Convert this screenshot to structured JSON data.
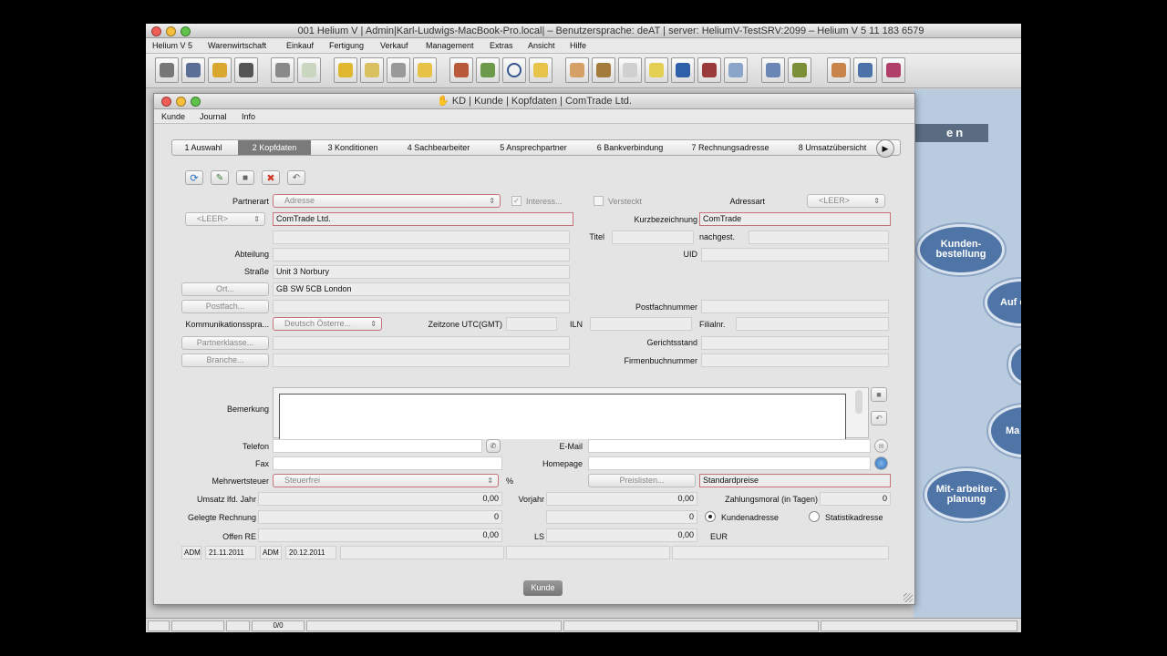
{
  "app": {
    "title": "001 Helium V | Admin|Karl-Ludwigs-MacBook-Pro.local| – Benutzersprache: deAT | server: HeliumV-TestSRV:2099 – Helium V 5 11 183 6579",
    "menu": [
      "Helium V 5",
      "Warenwirtschaft",
      "Einkauf",
      "Fertigung",
      "Verkauf",
      "Management",
      "Extras",
      "Ansicht",
      "Hilfe"
    ]
  },
  "background_panel": {
    "banner": "en",
    "bubbles": [
      "Kunden- bestellung",
      "Auf ert",
      "Ma be f",
      "Mit- arbeiter- planung"
    ]
  },
  "frame": {
    "title": "KD | Kunde | Kopfdaten | ComTrade Ltd.",
    "menu": [
      "Kunde",
      "Journal",
      "Info"
    ],
    "tabs": [
      "1 Auswahl",
      "2 Kopfdaten",
      "3 Konditionen",
      "4 Sachbearbeiter",
      "5 Ansprechpartner",
      "6 Bankverbindung",
      "7 Rechnungsadresse",
      "8 Umsatzübersicht"
    ],
    "active_tab": 1,
    "bottom_button": "Kunde"
  },
  "form": {
    "partnerart_label": "Partnerart",
    "partnerart_value": "Adresse",
    "interessent_label": "Interess...",
    "versteckt_label": "Versteckt",
    "adressart_label": "Adressart",
    "adressart_value": "<LEER>",
    "anrede_value": "<LEER>",
    "name_value": "ComTrade Ltd.",
    "kurzbezeichnung_label": "Kurzbezeichnung",
    "kurzbezeichnung_value": "ComTrade",
    "titel_label": "Titel",
    "nachgest_label": "nachgest.",
    "abteilung_label": "Abteilung",
    "uid_label": "UID",
    "strasse_label": "Straße",
    "strasse_value": "Unit 3 Norbury",
    "ort_button": "Ort...",
    "ort_value": "GB SW 5CB London",
    "postfach_button": "Postfach...",
    "postfachnummer_label": "Postfachnummer",
    "kommunikation_label": "Kommunikationsspra...",
    "kommunikation_value": "Deutsch Österre...",
    "zeitzone_label": "Zeitzone UTC(GMT)",
    "iln_label": "ILN",
    "filialnr_label": "Filialnr.",
    "partnerklasse_button": "Partnerklasse...",
    "gerichtsstand_label": "Gerichtsstand",
    "branche_button": "Branche...",
    "firmenbuchnummer_label": "Firmenbuchnummer",
    "bemerkung_label": "Bemerkung",
    "telefon_label": "Telefon",
    "email_label": "E-Mail",
    "fax_label": "Fax",
    "homepage_label": "Homepage",
    "mwst_label": "Mehrwertsteuer",
    "mwst_value": "Steuerfrei",
    "percent_label": "%",
    "preislisten_button": "Preislisten...",
    "preislisten_value": "Standardpreise",
    "umsatz_label": "Umsatz lfd. Jahr",
    "umsatz_value": "0,00",
    "vorjahr_label": "Vorjahr",
    "vorjahr_value": "0,00",
    "zahlungsmoral_label": "Zahlungsmoral (in Tagen)",
    "zahlungsmoral_value": "0",
    "gelegte_label": "Gelegte Rechnung",
    "gelegte_value": "0",
    "gelegte_value2": "0",
    "kundenadresse_label": "Kundenadresse",
    "statistikadresse_label": "Statistikadresse",
    "offen_label": "Offen RE",
    "offen_value": "0,00",
    "ls_label": "LS",
    "ls_value": "0,00",
    "currency": "EUR",
    "audit": [
      "ADM",
      "21.11.2011",
      "ADM",
      "20.12.2011"
    ]
  },
  "statusbar": {
    "counter": "0/0"
  }
}
